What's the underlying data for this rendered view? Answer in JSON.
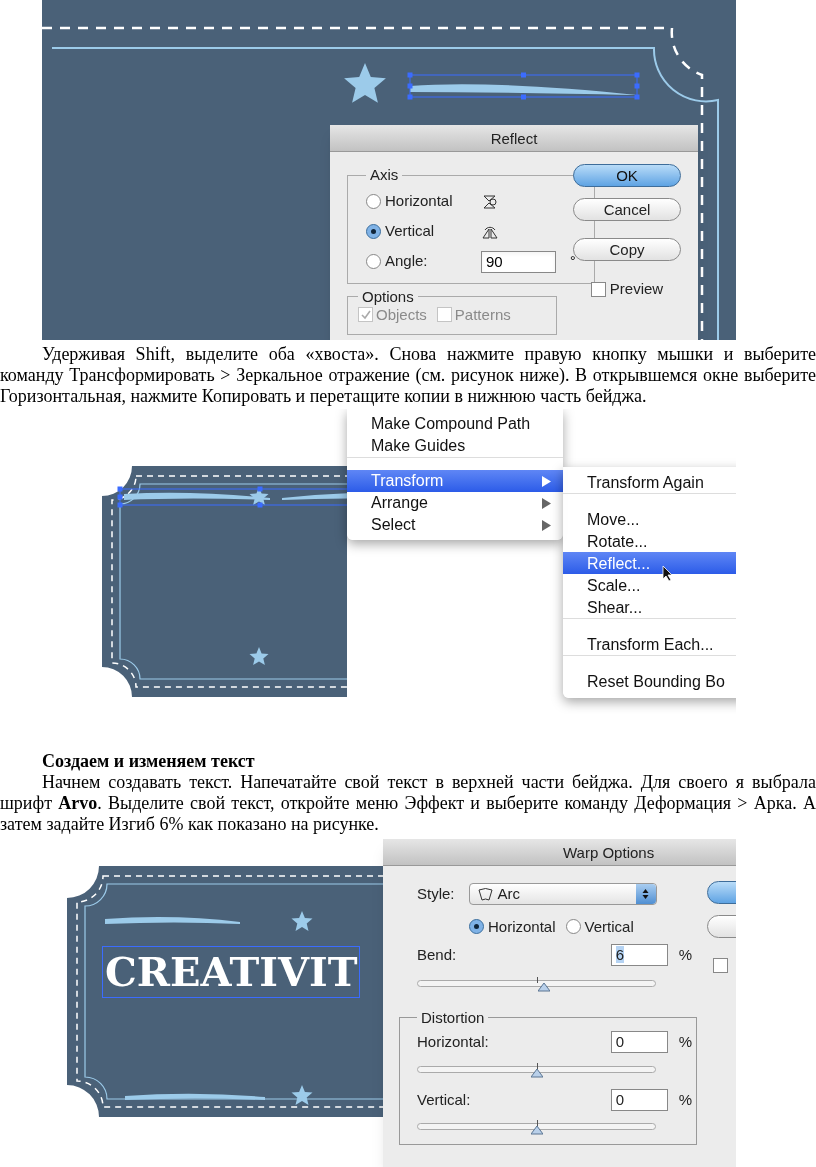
{
  "figure_1": {
    "dialog": {
      "title": "Reflect",
      "axis": {
        "label": "Axis",
        "options": [
          {
            "label": "Horizontal",
            "selected": false
          },
          {
            "label": "Vertical",
            "selected": true
          },
          {
            "label": "Angle:",
            "selected": false
          }
        ]
      },
      "angle": {
        "value": "90",
        "unit": "°"
      },
      "buttons": [
        {
          "label": "OK",
          "default": true
        },
        {
          "label": "Cancel",
          "default": false
        },
        {
          "label": "Copy",
          "default": false
        }
      ],
      "preview": {
        "label": "Preview",
        "checked": false
      },
      "options": {
        "label": "Options",
        "items": [
          {
            "label": "Objects",
            "checked": true,
            "disabled": true
          },
          {
            "label": "Patterns",
            "checked": false,
            "disabled": true
          }
        ]
      }
    }
  },
  "paragraph_1": "Удерживая Shift, выделите оба «хвоста». Снова нажмите правую кнопку мышки и выберите команду Трансформировать > Зеркальное отражение (см. рисунок ниже). В открывшемся окне выберите Горизонтальная, нажмите Копировать и перетащите копии в нижнюю часть бейджа.",
  "figure_2": {
    "menu": [
      {
        "label": "Make Compound Path",
        "selected": false,
        "submenu": false,
        "divider_after": false
      },
      {
        "label": "Make Guides",
        "selected": false,
        "submenu": false,
        "divider_after": true
      },
      {
        "label": "Transform",
        "selected": true,
        "submenu": true,
        "divider_after": false
      },
      {
        "label": "Arrange",
        "selected": false,
        "submenu": true,
        "divider_after": false
      },
      {
        "label": "Select",
        "selected": false,
        "submenu": true,
        "divider_after": false
      }
    ],
    "submenu": [
      {
        "label": "Transform Again",
        "selected": false,
        "divider_after": true
      },
      {
        "label": "Move...",
        "selected": false,
        "divider_after": false
      },
      {
        "label": "Rotate...",
        "selected": false,
        "divider_after": false
      },
      {
        "label": "Reflect...",
        "selected": true,
        "divider_after": false
      },
      {
        "label": "Scale...",
        "selected": false,
        "divider_after": false
      },
      {
        "label": "Shear...",
        "selected": false,
        "divider_after": true
      },
      {
        "label": "Transform Each...",
        "selected": false,
        "divider_after": true
      },
      {
        "label": "Reset Bounding Bo",
        "selected": false,
        "divider_after": false
      }
    ]
  },
  "heading": "Создаем и изменяем текст",
  "paragraph_2": "Начнем создавать текст. Напечатайте свой текст в верхней части бейджа. Для своего я выбрала шрифт **Arvo**. Выделите свой текст, откройте меню Эффект и выберите команду Деформация > Арка. А затем задайте Изгиб 6% как показано на рисунке.",
  "figure_3": {
    "badge_text": "CREATIVIT",
    "dialog": {
      "title": "Warp Options",
      "style_label": "Style:",
      "style_value": "Arc",
      "orientation": [
        {
          "label": "Horizontal",
          "selected": true
        },
        {
          "label": "Vertical",
          "selected": false
        }
      ],
      "side_checkbox": {
        "checked": false
      },
      "bend": {
        "label": "Bend:",
        "value": "6",
        "unit": "%",
        "level": 0.53
      },
      "distortion": {
        "label": "Distortion",
        "fields": [
          {
            "label": "Horizontal:",
            "value": "0",
            "unit": "%",
            "level": 0.5
          },
          {
            "label": "Vertical:",
            "value": "0",
            "unit": "%",
            "level": 0.5
          }
        ]
      }
    }
  }
}
